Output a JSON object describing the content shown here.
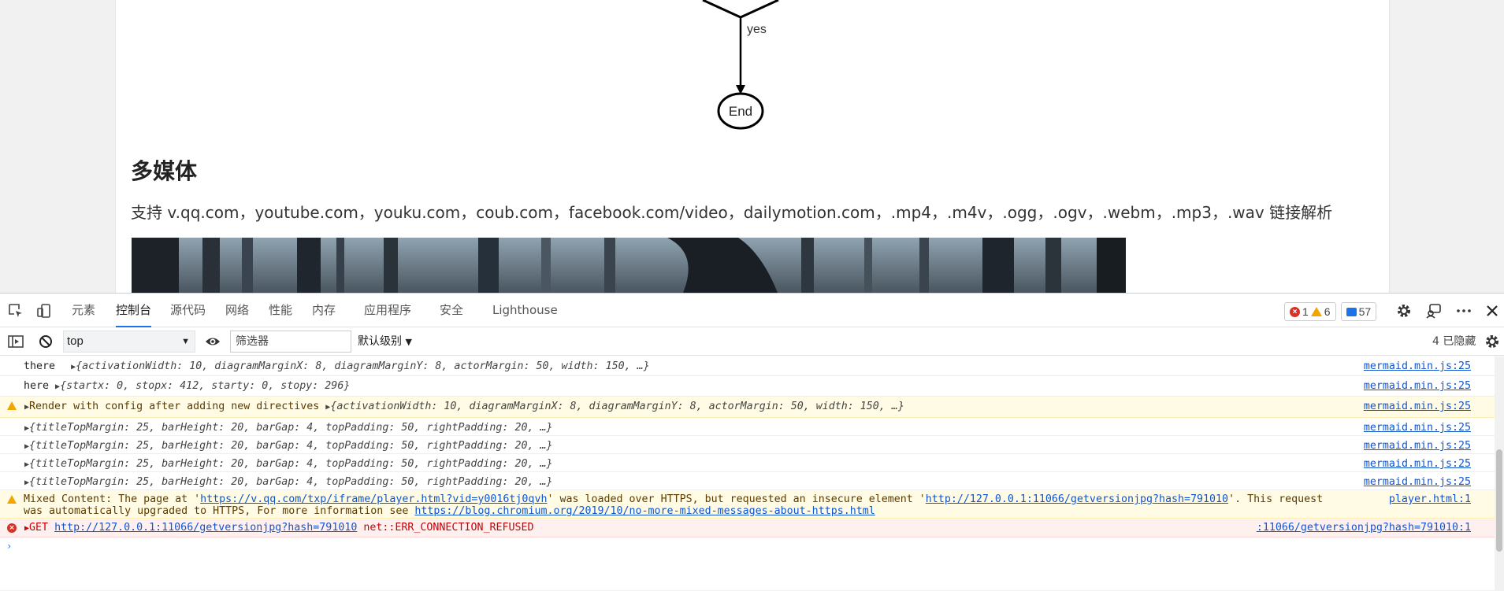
{
  "flowchart": {
    "edge_label": "yes",
    "end_node": "End"
  },
  "article": {
    "heading": "多媒体",
    "text": "支持 v.qq.com，youtube.com，youku.com，coub.com，facebook.com/video，dailymotion.com，.mp4，.m4v，.ogg，.ogv，.webm，.mp3，.wav 链接解析"
  },
  "devtools": {
    "tabs": [
      "元素",
      "控制台",
      "源代码",
      "网络",
      "性能",
      "内存",
      "应用程序",
      "安全",
      "Lighthouse"
    ],
    "active_tab": "控制台",
    "counters": {
      "errors": "1",
      "warnings": "6",
      "messages": "57"
    },
    "toolbar": {
      "context": "top",
      "filter_placeholder": "筛选器",
      "level": "默认级别",
      "hidden": "4 已隐藏"
    }
  },
  "console": {
    "rows": [
      {
        "prefix": "there",
        "obj": "{activationWidth: 10, diagramMarginX: 8, diagramMarginY: 8, actorMargin: 50, width: 150, …}",
        "src": "mermaid.min.js:25"
      },
      {
        "prefix": "here",
        "obj": "{startx: 0, stopx: 412, starty: 0, stopy: 296}",
        "src": "mermaid.min.js:25"
      },
      {
        "prefix": "Render with config after adding new directives",
        "obj": "{activationWidth: 10, diagramMarginX: 8, diagramMarginY: 8, actorMargin: 50, width: 150, …}",
        "src": "mermaid.min.js:25"
      },
      {
        "obj": "{titleTopMargin: 25, barHeight: 20, barGap: 4, topPadding: 50, rightPadding: 20, …}",
        "src": "mermaid.min.js:25"
      },
      {
        "obj": "{titleTopMargin: 25, barHeight: 20, barGap: 4, topPadding: 50, rightPadding: 20, …}",
        "src": "mermaid.min.js:25"
      },
      {
        "obj": "{titleTopMargin: 25, barHeight: 20, barGap: 4, topPadding: 50, rightPadding: 20, …}",
        "src": "mermaid.min.js:25"
      },
      {
        "obj": "{titleTopMargin: 25, barHeight: 20, barGap: 4, topPadding: 50, rightPadding: 20, …}",
        "src": "mermaid.min.js:25"
      }
    ],
    "mixed": {
      "p1": "Mixed Content: The page at '",
      "url1": "https://v.qq.com/txp/iframe/player.html?vid=y0016tj0qvh",
      "p2": "' was loaded over HTTPS, but requested an insecure element '",
      "url2": "http://127.0.0.1:11066/getversionjpg?hash=791010",
      "p3": "'. This request",
      "p4": "was automatically upgraded to HTTPS, For more information see ",
      "url3": "https://blog.chromium.org/2019/10/no-more-mixed-messages-about-https.html",
      "src": "player.html:1"
    },
    "error": {
      "method": "GET",
      "url": "http://127.0.0.1:11066/getversionjpg?hash=791010",
      "msg": "net::ERR_CONNECTION_REFUSED",
      "src": ":11066/getversionjpg?hash=791010:1"
    }
  }
}
